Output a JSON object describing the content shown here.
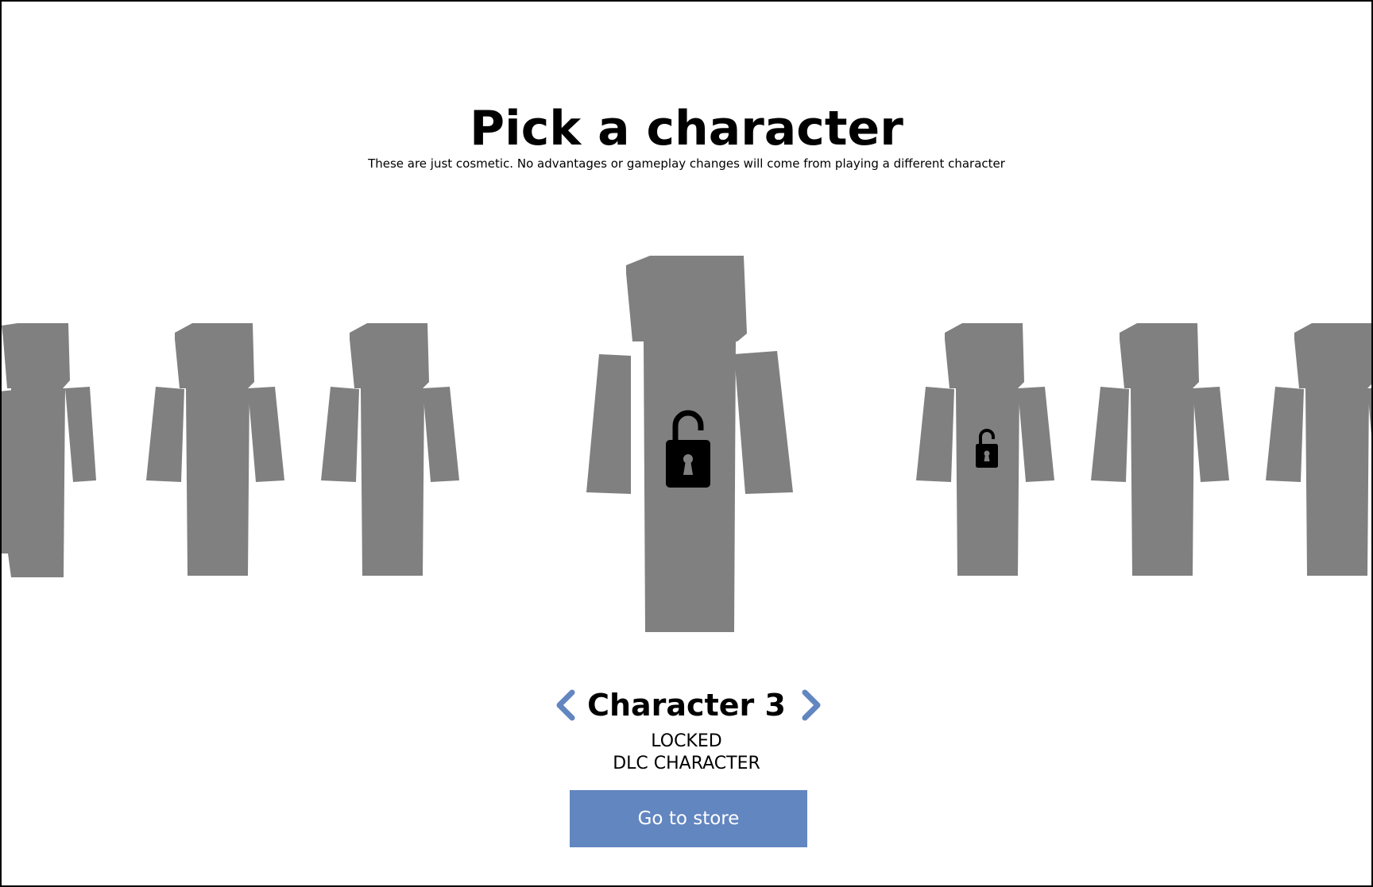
{
  "header": {
    "title": "Pick a character",
    "subtitle": "These are just cosmetic. No advantages or gameplay changes will come from playing a different character"
  },
  "carousel": {
    "characters": [
      {
        "locked": false
      },
      {
        "locked": false
      },
      {
        "locked": false
      },
      {
        "locked": true,
        "selected": true
      },
      {
        "locked": true
      },
      {
        "locked": false
      },
      {
        "locked": false
      }
    ],
    "figure_color": "#808080",
    "lock_color": "#000000",
    "lock_icon": "padlock-open-icon"
  },
  "selection": {
    "name": "Character 3",
    "status_line1": "LOCKED",
    "status_line2": "DLC CHARACTER",
    "prev_icon": "chevron-left-icon",
    "next_icon": "chevron-right-icon",
    "arrow_color": "#6286c0"
  },
  "store": {
    "button_label": "Go to store",
    "button_color": "#6286c0"
  }
}
